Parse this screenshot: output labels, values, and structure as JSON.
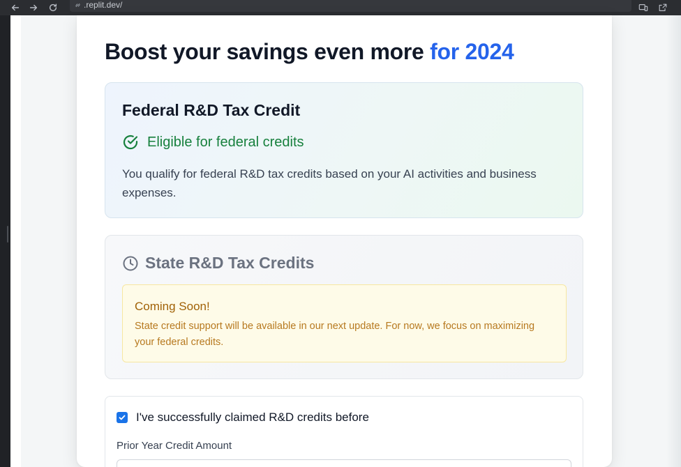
{
  "browser": {
    "url": ".replit.dev/"
  },
  "page": {
    "title_main": "Boost your savings even more ",
    "title_accent": "for 2024"
  },
  "federal": {
    "title": "Federal R&D Tax Credit",
    "status": "Eligible for federal credits",
    "description": "You qualify for federal R&D tax credits based on your AI activities and business expenses."
  },
  "state": {
    "title": "State R&D Tax Credits",
    "notice_title": "Coming Soon!",
    "notice_text": "State credit support will be available in our next update. For now, we focus on maximizing your federal credits."
  },
  "prior_claims": {
    "checkbox_label": "I've successfully claimed R&D credits before",
    "checked": true,
    "amount_label": "Prior Year Credit Amount",
    "amount_value": ""
  },
  "colors": {
    "accent": "#2563eb",
    "success": "#17803d",
    "warning": "#a16207"
  }
}
